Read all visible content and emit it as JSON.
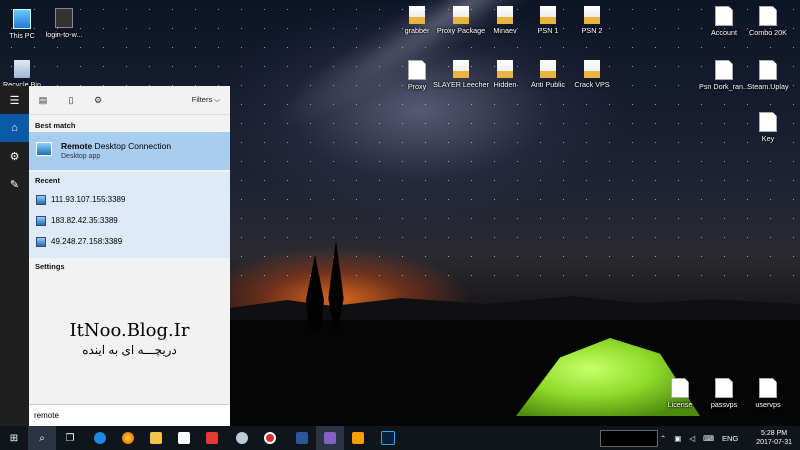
{
  "desktop": {
    "icons_left": [
      {
        "label": "This PC",
        "icon": "computer-icon"
      },
      {
        "label": "login-to-w...",
        "icon": "app-icon"
      },
      {
        "label": "Recycle Bin",
        "icon": "recycle-bin-icon"
      }
    ],
    "icons_top": [
      {
        "label": "grabber",
        "icon": "folder-icon"
      },
      {
        "label": "Proxy Package",
        "icon": "folder-icon"
      },
      {
        "label": "Minaev",
        "icon": "folder-icon"
      },
      {
        "label": "PSN 1",
        "icon": "folder-icon"
      },
      {
        "label": "PSN 2",
        "icon": "folder-icon"
      },
      {
        "label": "Account",
        "icon": "document-icon"
      },
      {
        "label": "Combo 20K",
        "icon": "document-icon"
      }
    ],
    "icons_row2": [
      {
        "label": "Proxy",
        "icon": "document-icon"
      },
      {
        "label": "SLAYER Leecher",
        "icon": "folder-icon"
      },
      {
        "label": "Hidden",
        "icon": "folder-icon"
      },
      {
        "label": "Anti Public",
        "icon": "folder-icon"
      },
      {
        "label": "Crack VPS",
        "icon": "folder-icon"
      },
      {
        "label": "Psn Dork_ran...",
        "icon": "document-icon"
      },
      {
        "label": "Steam.Uplay",
        "icon": "document-icon"
      }
    ],
    "icons_right": [
      {
        "label": "Key",
        "icon": "document-icon"
      }
    ],
    "icons_bottom": [
      {
        "label": "License",
        "icon": "document-icon"
      },
      {
        "label": "passvps",
        "icon": "document-icon"
      },
      {
        "label": "uservps",
        "icon": "document-icon"
      }
    ]
  },
  "start_menu": {
    "filters_label": "Filters",
    "best_match_header": "Best match",
    "best_match": {
      "title_bold": "Remote",
      "title_rest": " Desktop Connection",
      "subtitle": "Desktop app"
    },
    "recent_header": "Recent",
    "recent": [
      "111.93.107.155:3389",
      "183.82.42.35:3389",
      "49.248.27.158:3389"
    ],
    "settings_header": "Settings",
    "watermark_line1": "ItNoo.Blog.Ir",
    "watermark_line2": "دریچـــه ای به اینده",
    "search_value": "remote"
  },
  "taskbar": {
    "language": "ENG",
    "time": "5:28 PM",
    "date": "2017-07-31"
  }
}
